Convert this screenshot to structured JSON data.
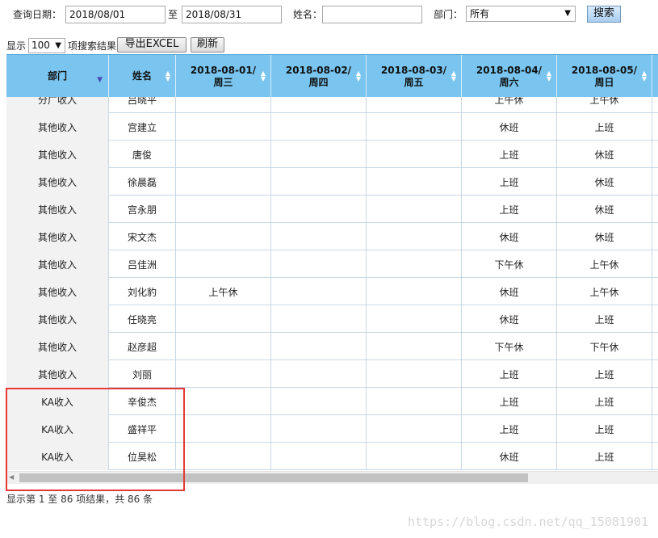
{
  "filters": {
    "date_label": "查询日期：",
    "date_from": "2018/08/01",
    "date_to_label": "至",
    "date_to": "2018/08/31",
    "name_label": "姓名：",
    "name_value": "",
    "dept_label": "部门：",
    "dept_selected": "所有",
    "search_button": "搜索"
  },
  "toolbar": {
    "show_label": "显示",
    "page_size": "100",
    "result_label": "项搜索结果",
    "export_button": "导出EXCEL",
    "refresh_button": "刷新"
  },
  "table": {
    "headers": {
      "dept": "部门",
      "name": "姓名",
      "d1": [
        "2018-08-01/",
        "周三"
      ],
      "d2": [
        "2018-08-02/",
        "周四"
      ],
      "d3": [
        "2018-08-03/",
        "周五"
      ],
      "d4": [
        "2018-08-04/",
        "周六"
      ],
      "d5": [
        "2018-08-05/",
        "周日"
      ]
    },
    "partial_row": [
      "分广收入",
      "吕晓平",
      "",
      "",
      "",
      "上午休",
      "上午休"
    ],
    "rows": [
      [
        "其他收入",
        "宫建立",
        "",
        "",
        "",
        "休班",
        "上班"
      ],
      [
        "其他收入",
        "唐俊",
        "",
        "",
        "",
        "上班",
        "休班"
      ],
      [
        "其他收入",
        "徐晨磊",
        "",
        "",
        "",
        "上班",
        "休班"
      ],
      [
        "其他收入",
        "宫永朋",
        "",
        "",
        "",
        "上班",
        "休班"
      ],
      [
        "其他收入",
        "宋文杰",
        "",
        "",
        "",
        "休班",
        "休班"
      ],
      [
        "其他收入",
        "吕佳洲",
        "",
        "",
        "",
        "下午休",
        "上午休"
      ],
      [
        "其他收入",
        "刘化豹",
        "上午休",
        "",
        "",
        "休班",
        "上午休"
      ],
      [
        "其他收入",
        "任晓亮",
        "",
        "",
        "",
        "休班",
        "上班"
      ],
      [
        "其他收入",
        "赵彦超",
        "",
        "",
        "",
        "下午休",
        "下午休"
      ],
      [
        "其他收入",
        "刘丽",
        "",
        "",
        "",
        "上班",
        "上班"
      ],
      [
        "KA收入",
        "辛俊杰",
        "",
        "",
        "",
        "上班",
        "上班"
      ],
      [
        "KA收入",
        "盛祥平",
        "",
        "",
        "",
        "上班",
        "上班"
      ],
      [
        "KA收入",
        "位昊松",
        "",
        "",
        "",
        "休班",
        "上班"
      ]
    ]
  },
  "footer": {
    "info": "显示第 1 至 86 项结果，共 86 条"
  },
  "watermark": "https://blog.csdn.net/qq_15081901",
  "colors": {
    "header_bg": "#79c5ef",
    "highlight_box": "#e53935"
  }
}
